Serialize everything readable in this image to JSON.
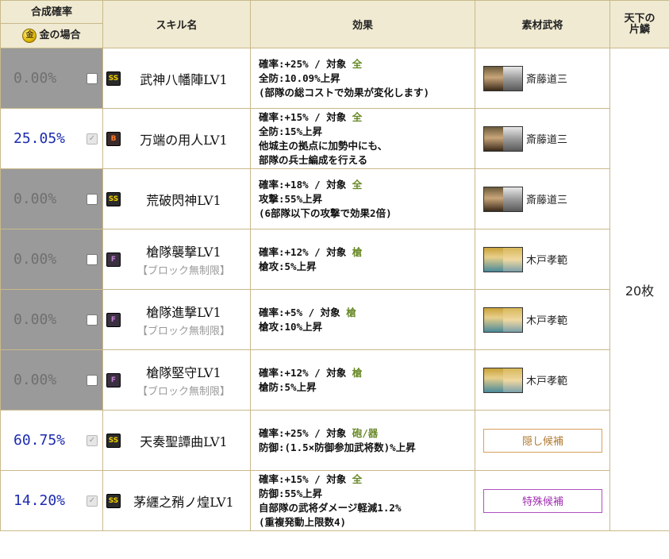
{
  "headers": {
    "rate_top": "合成確率",
    "rate_bottom": "金の場合",
    "coin_glyph": "金",
    "skill": "スキル名",
    "effect": "効果",
    "material": "素材武将",
    "tenka_line1": "天下の",
    "tenka_line2": "片鱗"
  },
  "tenka_value": "20枚",
  "rows": [
    {
      "rate": "0.00%",
      "style": "gray",
      "checked": false,
      "rank": "SS",
      "name": "武神八幡陣LV1",
      "note": "",
      "effect": [
        {
          "text": "確率:+25% / 対象 ",
          "target": "全"
        },
        {
          "text": "全防:10.09%上昇"
        },
        {
          "text": "(部隊の総コストで効果が変化します)"
        }
      ],
      "material": {
        "type": "portrait",
        "portrait": "doshi",
        "name": "斎藤道三"
      }
    },
    {
      "rate": "25.05%",
      "style": "white",
      "checked": true,
      "rank": "B",
      "name": "万端の用人LV1",
      "note": "",
      "effect": [
        {
          "text": "確率:+15% / 対象 ",
          "target": "全"
        },
        {
          "text": "全防:15%上昇"
        },
        {
          "text": "他城主の拠点に加勢中にも、"
        },
        {
          "text": "部隊の兵士編成を行える"
        }
      ],
      "material": {
        "type": "portrait",
        "portrait": "doshi",
        "name": "斎藤道三"
      }
    },
    {
      "rate": "0.00%",
      "style": "gray",
      "checked": false,
      "rank": "SS",
      "name": "荒破閃神LV1",
      "note": "",
      "effect": [
        {
          "text": "確率:+18% / 対象 ",
          "target": "全"
        },
        {
          "text": "攻撃:55%上昇"
        },
        {
          "text": "(6部隊以下の攻撃で効果2倍)"
        }
      ],
      "material": {
        "type": "portrait",
        "portrait": "doshi",
        "name": "斎藤道三"
      }
    },
    {
      "rate": "0.00%",
      "style": "gray",
      "checked": false,
      "rank": "F",
      "name": "槍隊襲撃LV1",
      "note": "【ブロック無制限】",
      "effect": [
        {
          "text": "確率:+12% / 対象 ",
          "target": "槍"
        },
        {
          "text": "槍攻:5%上昇"
        }
      ],
      "material": {
        "type": "portrait",
        "portrait": "kido",
        "name": "木戸孝範"
      }
    },
    {
      "rate": "0.00%",
      "style": "gray",
      "checked": false,
      "rank": "F",
      "name": "槍隊進撃LV1",
      "note": "【ブロック無制限】",
      "effect": [
        {
          "text": "確率:+5% / 対象 ",
          "target": "槍"
        },
        {
          "text": "槍攻:10%上昇"
        }
      ],
      "material": {
        "type": "portrait",
        "portrait": "kido",
        "name": "木戸孝範"
      }
    },
    {
      "rate": "0.00%",
      "style": "gray",
      "checked": false,
      "rank": "F",
      "name": "槍隊堅守LV1",
      "note": "【ブロック無制限】",
      "effect": [
        {
          "text": "確率:+12% / 対象 ",
          "target": "槍"
        },
        {
          "text": "槍防:5%上昇"
        }
      ],
      "material": {
        "type": "portrait",
        "portrait": "kido",
        "name": "木戸孝範"
      }
    },
    {
      "rate": "60.75%",
      "style": "white",
      "checked": true,
      "rank": "SS",
      "name": "天奏聖譚曲LV1",
      "note": "",
      "effect": [
        {
          "text": "確率:+25% / 対象 ",
          "target": "砲/器"
        },
        {
          "text": "防御:(1.5×防御参加武将数)%上昇"
        }
      ],
      "material": {
        "type": "button",
        "variant": "hidden",
        "label": "隠し候補"
      }
    },
    {
      "rate": "14.20%",
      "style": "white",
      "checked": true,
      "rank": "SS",
      "name": "茅纒之矟ノ煌LV1",
      "note": "",
      "effect": [
        {
          "text": "確率:+15% / 対象 ",
          "target": "全"
        },
        {
          "text": "防御:55%上昇"
        },
        {
          "text": "自部隊の武将ダメージ軽減1.2%"
        },
        {
          "text": "(重複発動上限数4)"
        }
      ],
      "material": {
        "type": "button",
        "variant": "special",
        "label": "特殊候補"
      }
    }
  ]
}
